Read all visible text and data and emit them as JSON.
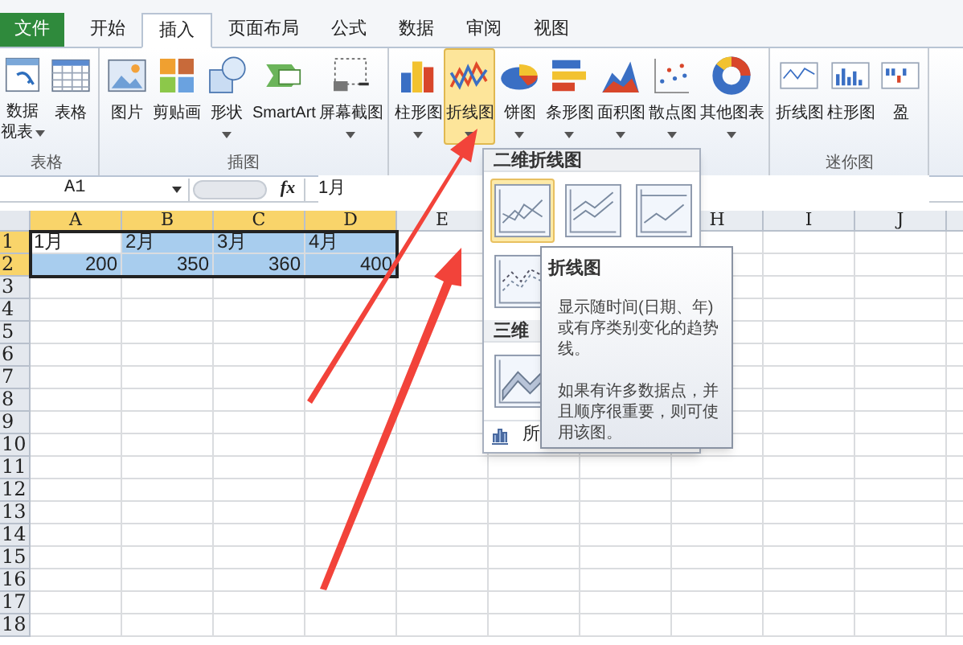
{
  "tabs": [
    {
      "label": "文件",
      "kind": "file",
      "selected": false
    },
    {
      "label": "开始",
      "kind": "tab",
      "selected": false
    },
    {
      "label": "插入",
      "kind": "tab",
      "selected": true
    },
    {
      "label": "页面布局",
      "kind": "tab",
      "selected": false
    },
    {
      "label": "公式",
      "kind": "tab",
      "selected": false
    },
    {
      "label": "数据",
      "kind": "tab",
      "selected": false
    },
    {
      "label": "审阅",
      "kind": "tab",
      "selected": false
    },
    {
      "label": "视图",
      "kind": "tab",
      "selected": false
    }
  ],
  "ribbon": {
    "groups": [
      {
        "label": "表格",
        "buttons": [
          {
            "label": "数据",
            "label2": "视表",
            "kind": "pivot",
            "dropdown": true,
            "selected": false
          },
          {
            "label": "表格",
            "kind": "table",
            "dropdown": false,
            "selected": false
          }
        ]
      },
      {
        "label": "插图",
        "buttons": [
          {
            "label": "图片",
            "kind": "picture",
            "dropdown": false,
            "selected": false
          },
          {
            "label": "剪贴画",
            "kind": "clipart",
            "dropdown": false,
            "selected": false
          },
          {
            "label": "形状",
            "kind": "shapes",
            "dropdown": true,
            "selected": false
          },
          {
            "label": "SmartArt",
            "kind": "smartart",
            "dropdown": false,
            "selected": false
          },
          {
            "label": "屏幕截图",
            "kind": "screenshot",
            "dropdown": true,
            "selected": false
          }
        ]
      },
      {
        "buttons": [
          {
            "label": "柱形图",
            "kind": "column",
            "dropdown": true,
            "selected": false
          },
          {
            "label": "折线图",
            "kind": "line",
            "dropdown": true,
            "selected": true
          },
          {
            "label": "饼图",
            "kind": "pie",
            "dropdown": true,
            "selected": false
          },
          {
            "label": "条形图",
            "kind": "bar",
            "dropdown": true,
            "selected": false
          },
          {
            "label": "面积图",
            "kind": "area",
            "dropdown": true,
            "selected": false
          },
          {
            "label": "散点图",
            "kind": "scatter",
            "dropdown": true,
            "selected": false
          },
          {
            "label": "其他图表",
            "kind": "donut",
            "dropdown": true,
            "selected": false
          }
        ]
      },
      {
        "label": "迷你图",
        "buttons": [
          {
            "label": "折线图",
            "kind": "spark-line",
            "dropdown": false,
            "selected": false
          },
          {
            "label": "柱形图",
            "kind": "spark-column",
            "dropdown": false,
            "selected": false
          },
          {
            "label": "盈",
            "kind": "spark-winloss",
            "dropdown": false,
            "selected": false
          }
        ]
      }
    ]
  },
  "formula_bar": {
    "name_box": "A1",
    "fx": "fx",
    "value": "1月"
  },
  "sheet": {
    "columns": [
      {
        "label": "A",
        "selected": true
      },
      {
        "label": "B",
        "selected": true
      },
      {
        "label": "C",
        "selected": true
      },
      {
        "label": "D",
        "selected": true
      },
      {
        "label": "E",
        "selected": false
      },
      {
        "label": "H",
        "selected": false
      },
      {
        "label": "I",
        "selected": false
      },
      {
        "label": "J",
        "selected": false
      }
    ],
    "rows": [
      {
        "label": "1",
        "selected": true,
        "cells": [
          {
            "text": "1月",
            "kind": "text",
            "selected": false
          },
          {
            "text": "2月",
            "kind": "text",
            "selected": true
          },
          {
            "text": "3月",
            "kind": "text",
            "selected": true
          },
          {
            "text": "4月",
            "kind": "text",
            "selected": true
          }
        ]
      },
      {
        "label": "2",
        "selected": true,
        "cells": [
          {
            "text": "200",
            "kind": "number",
            "selected": true
          },
          {
            "text": "350",
            "kind": "number",
            "selected": true
          },
          {
            "text": "360",
            "kind": "number",
            "selected": true
          },
          {
            "text": "400",
            "kind": "number",
            "selected": true
          }
        ]
      },
      {
        "label": "3",
        "selected": false
      },
      {
        "label": "4",
        "selected": false
      },
      {
        "label": "5",
        "selected": false
      },
      {
        "label": "6",
        "selected": false
      },
      {
        "label": "7",
        "selected": false
      },
      {
        "label": "8",
        "selected": false
      },
      {
        "label": "9",
        "selected": false
      },
      {
        "label": "10",
        "selected": false
      },
      {
        "label": "11",
        "selected": false
      },
      {
        "label": "12",
        "selected": false
      },
      {
        "label": "13",
        "selected": false
      },
      {
        "label": "14",
        "selected": false
      },
      {
        "label": "15",
        "selected": false
      },
      {
        "label": "16",
        "selected": false
      },
      {
        "label": "17",
        "selected": false
      },
      {
        "label": "18",
        "selected": false
      }
    ]
  },
  "line_menu": {
    "sections": [
      {
        "heading": "二维折线图",
        "items": [
          {
            "kind": "line",
            "selected": true
          },
          {
            "kind": "stacked-line",
            "selected": false
          },
          {
            "kind": "percent-line",
            "selected": false
          },
          {
            "kind": "line-markers",
            "selected": false
          }
        ]
      },
      {
        "heading": "三维",
        "items": [
          {
            "kind": "line-3d",
            "selected": false
          }
        ]
      }
    ],
    "footer": "所"
  },
  "tooltip": {
    "title": "折线图",
    "paragraphs": [
      "显示随时间(日期、年)或有序类别变化的趋势线。",
      "如果有许多数据点，并且顺序很重要，则可使用该图。"
    ]
  }
}
